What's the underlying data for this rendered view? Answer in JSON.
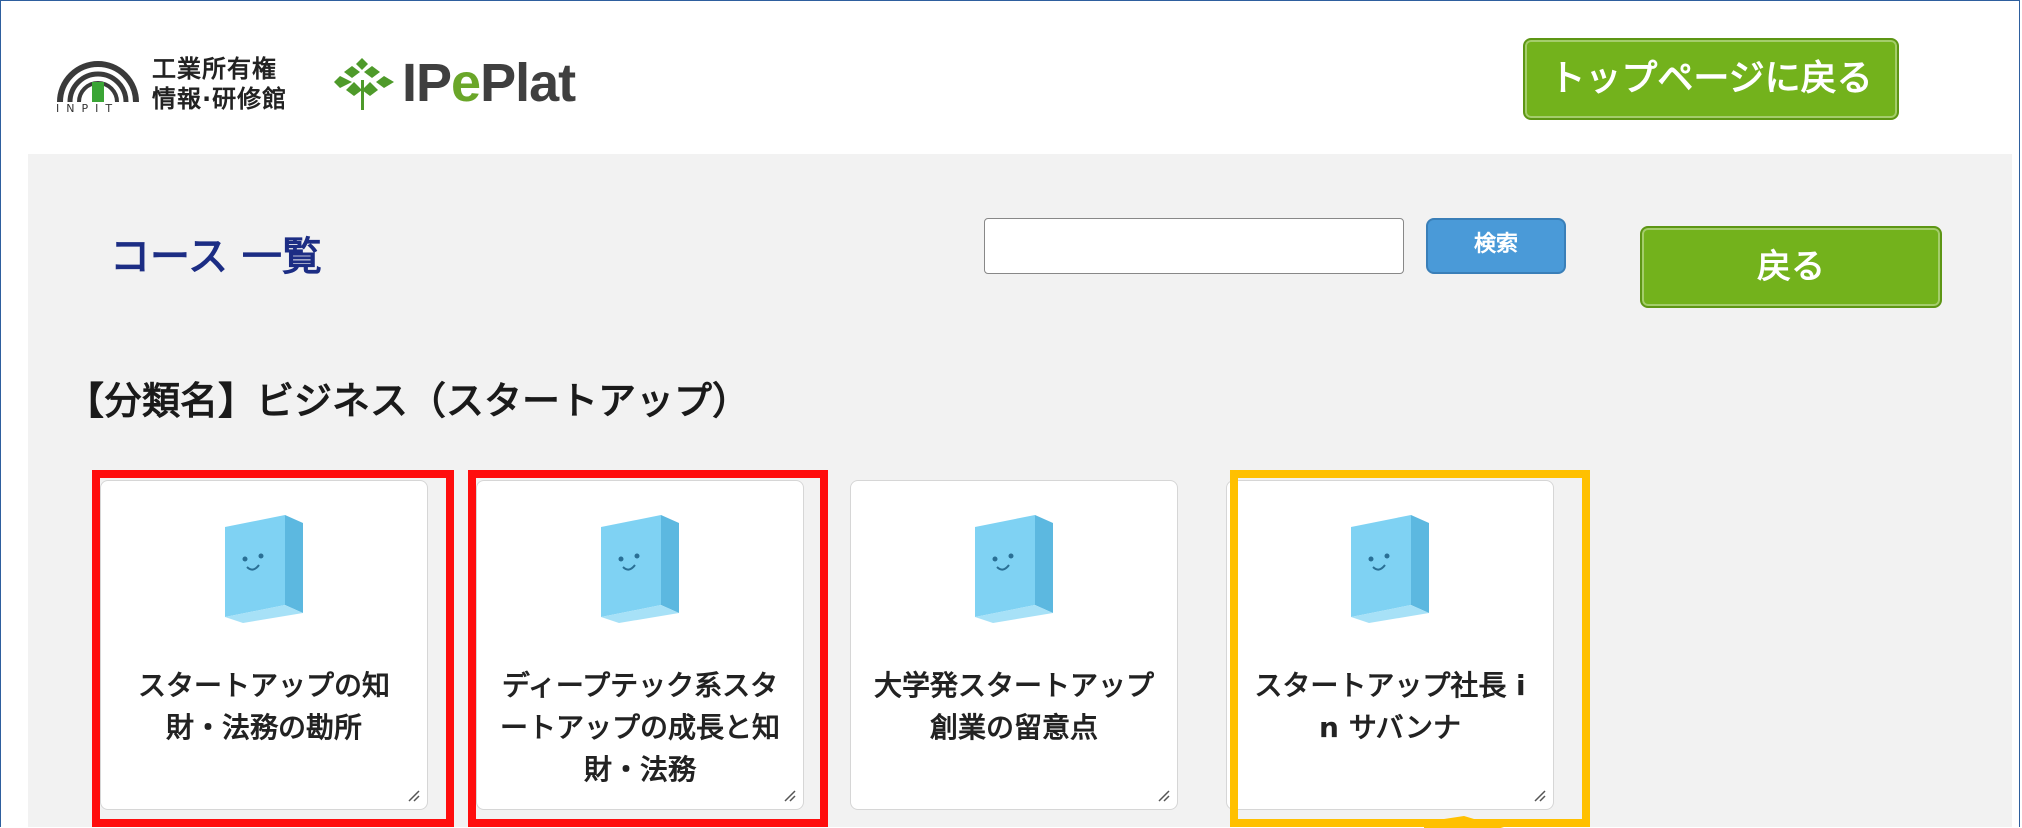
{
  "header": {
    "inpit_logo": {
      "name_line1": "工業所有権",
      "name_line2": "情報·研修館",
      "abbrev": "INPIT"
    },
    "ipeplat_logo": {
      "ip": "IP",
      "e": "e",
      "plat": "Plat"
    },
    "top_page_button": "トップページに戻る"
  },
  "main": {
    "title": "コース 一覧",
    "search": {
      "value": "",
      "placeholder": "",
      "button": "検索"
    },
    "back_button": "戻る",
    "category_title": "【分類名】ビジネス（スタートアップ）",
    "courses": [
      {
        "title": "スタートアップの知財・法務の勘所",
        "icon": "book-icon",
        "highlight": "red"
      },
      {
        "title": "ディープテック系スタートアップの成長と知財・法務",
        "icon": "book-icon",
        "highlight": "red"
      },
      {
        "title": "大学発スタートアップ創業の留意点",
        "icon": "book-icon",
        "highlight": "none"
      },
      {
        "title": "スタートアップ社長 i n サバンナ",
        "icon": "book-icon",
        "highlight": "yellow"
      }
    ]
  },
  "colors": {
    "accent_green": "#73b21c",
    "title_navy": "#1c2d84",
    "search_blue": "#4a9ad8",
    "highlight_red": "#ff0d0d",
    "highlight_yellow": "#ffc000"
  }
}
